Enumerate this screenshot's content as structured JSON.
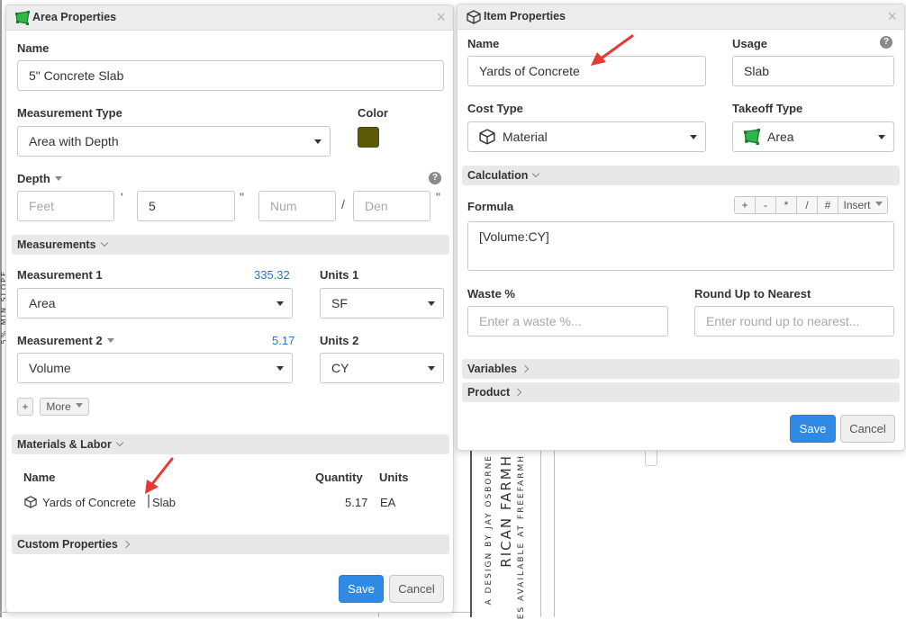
{
  "background": {
    "vertical_text_1": "A DESIGN BY JAY OSBORNE",
    "vertical_text_2": "RICAN FARMH",
    "vertical_text_3": "ES AVAILABLE AT FREEFARMH",
    "left_edge_text": "5% MIN SLOPE"
  },
  "area_properties": {
    "title": "Area Properties",
    "name_label": "Name",
    "name_value": "5\" Concrete Slab",
    "measurement_type_label": "Measurement Type",
    "measurement_type_value": "Area with Depth",
    "color_label": "Color",
    "color_value": "#5c5a06",
    "depth_label": "Depth",
    "depth_feet_placeholder": "Feet",
    "depth_feet_sep": "'",
    "depth_inches_value": "5",
    "depth_inches_sep": "\"",
    "depth_num_placeholder": "Num",
    "depth_frac_sep": "/",
    "depth_den_placeholder": "Den",
    "depth_den_sep": "\"",
    "measurements_section": "Measurements",
    "measurement1_label": "Measurement 1",
    "measurement1_quantity": "335.32",
    "measurement1_value": "Area",
    "units1_label": "Units 1",
    "units1_value": "SF",
    "measurement2_label": "Measurement 2",
    "measurement2_quantity": "5.17",
    "measurement2_value": "Volume",
    "units2_label": "Units 2",
    "units2_value": "CY",
    "add_label": "+",
    "more_label": "More",
    "materials_section": "Materials & Labor",
    "materials_columns": {
      "name": "Name",
      "quantity": "Quantity",
      "units": "Units"
    },
    "materials_rows": [
      {
        "name": "Yards of Concrete",
        "usage": "Slab",
        "quantity": "5.17",
        "units": "EA"
      }
    ],
    "custom_section": "Custom Properties",
    "save_label": "Save",
    "cancel_label": "Cancel"
  },
  "item_properties": {
    "title": "Item Properties",
    "name_label": "Name",
    "name_value": "Yards of Concrete",
    "usage_label": "Usage",
    "usage_value": "Slab",
    "cost_type_label": "Cost Type",
    "cost_type_value": "Material",
    "takeoff_type_label": "Takeoff Type",
    "takeoff_type_value": "Area",
    "calculation_section": "Calculation",
    "formula_label": "Formula",
    "formula_ops": [
      "+",
      "-",
      "*",
      "/",
      "#"
    ],
    "insert_label": "Insert",
    "formula_value": "[Volume:CY]",
    "waste_label": "Waste %",
    "waste_placeholder": "Enter a waste %...",
    "roundup_label": "Round Up to Nearest",
    "roundup_placeholder": "Enter round up to nearest...",
    "variables_section": "Variables",
    "product_section": "Product",
    "save_label": "Save",
    "cancel_label": "Cancel"
  },
  "colors": {
    "accent": "#2f8ae5",
    "link": "#2a74c9",
    "annotation_arrow": "#e53935",
    "area_icon": "#2fb84a"
  }
}
